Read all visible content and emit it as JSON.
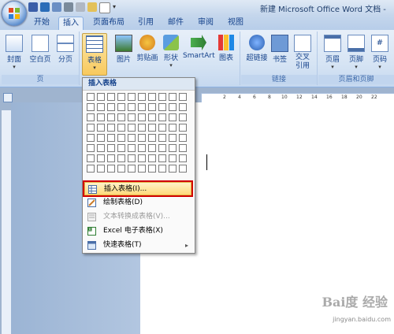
{
  "window": {
    "title": "新建 Microsoft Office Word 文档 -"
  },
  "tabs": [
    "开始",
    "插入",
    "页面布局",
    "引用",
    "邮件",
    "审阅",
    "视图"
  ],
  "active_tab": "插入",
  "ribbon": {
    "pages_group": {
      "label": "页",
      "buttons": [
        "封面",
        "空白页",
        "分页"
      ]
    },
    "table_button": "表格",
    "illus_buttons": [
      "图片",
      "剪贴画",
      "形状",
      "SmartArt",
      "图表"
    ],
    "links_group": {
      "label": "链接",
      "buttons": [
        "超链接",
        "书签",
        "交叉\n引用"
      ]
    },
    "header_group": {
      "label": "页眉和页脚",
      "buttons": [
        "页眉",
        "页脚",
        "页码"
      ]
    }
  },
  "ruler": {
    "ticks": [
      "2",
      "4",
      "6",
      "8",
      "10",
      "12",
      "14",
      "16",
      "18",
      "20",
      "22"
    ]
  },
  "menu": {
    "header": "插入表格",
    "grid": {
      "cols": 10,
      "rows": 8
    },
    "items": [
      {
        "label": "插入表格(I)...",
        "icon": "insert-table-icon",
        "highlight": true,
        "disabled": false,
        "submenu": false
      },
      {
        "label": "绘制表格(D)",
        "icon": "draw-table-icon",
        "highlight": false,
        "disabled": false,
        "submenu": false
      },
      {
        "label": "文本转换成表格(V)...",
        "icon": "convert-text-icon",
        "highlight": false,
        "disabled": true,
        "submenu": false
      },
      {
        "label": "Excel 电子表格(X)",
        "icon": "excel-icon",
        "highlight": false,
        "disabled": false,
        "submenu": false
      },
      {
        "label": "快速表格(T)",
        "icon": "quick-table-icon",
        "highlight": false,
        "disabled": false,
        "submenu": true
      }
    ]
  },
  "watermark": {
    "logo": "Bai度 经验",
    "url": "jingyan.baidu.com"
  }
}
